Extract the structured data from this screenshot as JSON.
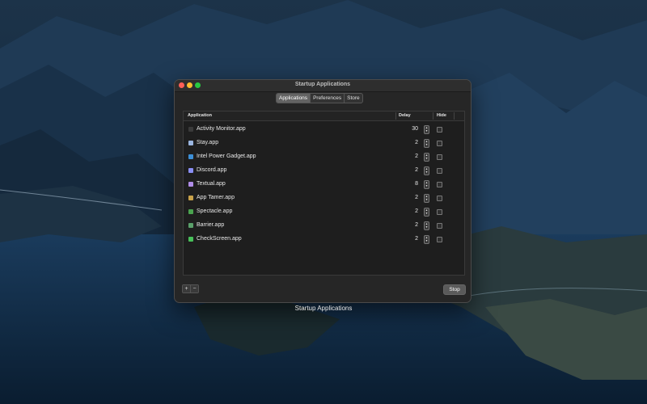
{
  "window": {
    "title": "Startup Applications",
    "tabs": [
      {
        "label": "Applications",
        "active": true
      },
      {
        "label": "Preferences",
        "active": false
      },
      {
        "label": "Store",
        "active": false
      }
    ]
  },
  "table": {
    "headers": {
      "application": "Application",
      "delay": "Delay",
      "hide": "Hide"
    },
    "rows": [
      {
        "name": "Activity Monitor.app",
        "delay": "30",
        "hide": false,
        "icon": "activity-monitor-icon",
        "color": "#3a3a3a"
      },
      {
        "name": "Stay.app",
        "delay": "2",
        "hide": false,
        "icon": "stay-icon",
        "color": "#9bb6e0"
      },
      {
        "name": "Intel Power Gadget.app",
        "delay": "2",
        "hide": false,
        "icon": "intel-power-gadget-icon",
        "color": "#3d8fd6"
      },
      {
        "name": "Discord.app",
        "delay": "2",
        "hide": false,
        "icon": "discord-icon",
        "color": "#8a8ff5"
      },
      {
        "name": "Textual.app",
        "delay": "8",
        "hide": false,
        "icon": "textual-icon",
        "color": "#b08de8"
      },
      {
        "name": "App Tamer.app",
        "delay": "2",
        "hide": false,
        "icon": "app-tamer-icon",
        "color": "#c9a24a"
      },
      {
        "name": "Spectacle.app",
        "delay": "2",
        "hide": false,
        "icon": "spectacle-icon",
        "color": "#4aa34f"
      },
      {
        "name": "Barrier.app",
        "delay": "2",
        "hide": false,
        "icon": "barrier-icon",
        "color": "#5aa06a"
      },
      {
        "name": "CheckScreen.app",
        "delay": "2",
        "hide": false,
        "icon": "checkscreen-icon",
        "color": "#48c05a"
      }
    ]
  },
  "footer": {
    "add_label": "+",
    "remove_label": "−",
    "stop_label": "Stop"
  },
  "caption": "Startup Applications"
}
